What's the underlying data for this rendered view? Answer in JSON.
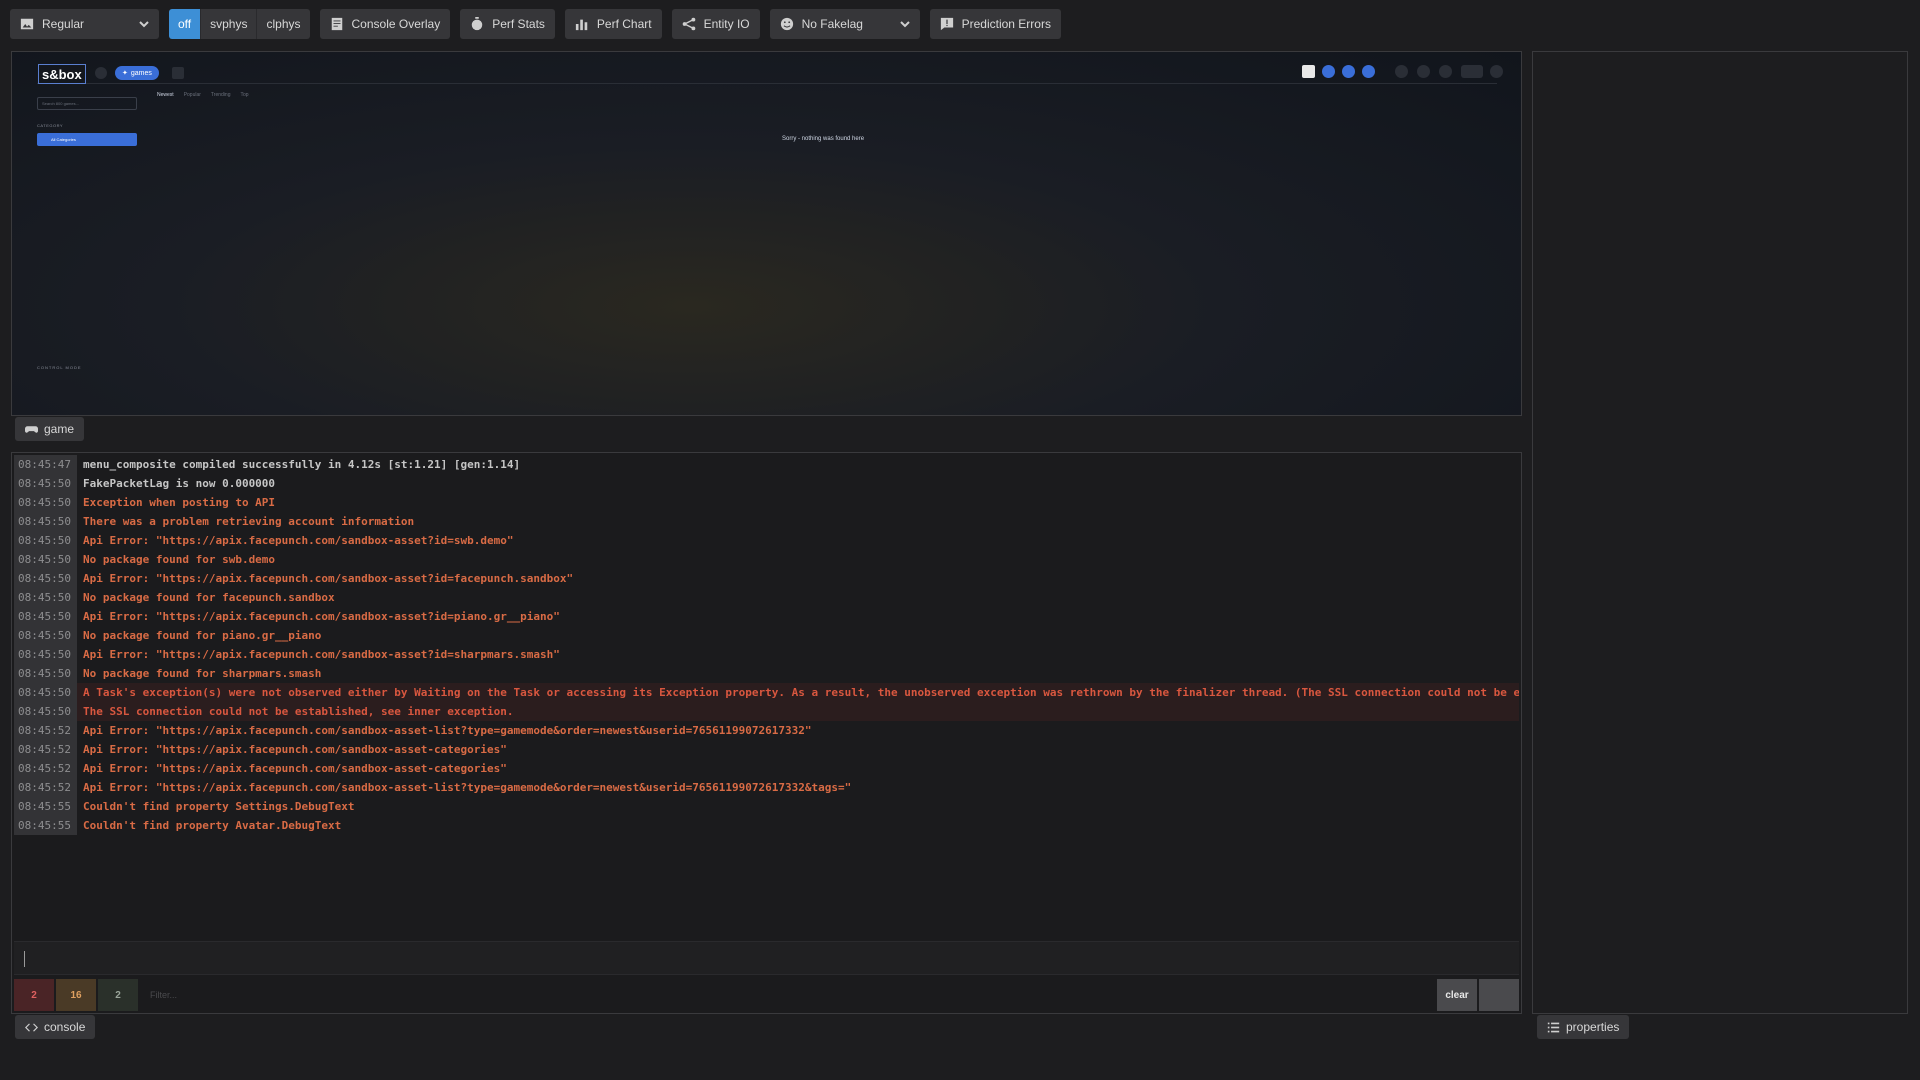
{
  "toolbar": {
    "mode_select": "Regular",
    "physics_segments": [
      {
        "label": "off",
        "active": true
      },
      {
        "label": "svphys",
        "active": false
      },
      {
        "label": "clphys",
        "active": false
      }
    ],
    "console_overlay": "Console Overlay",
    "perf_stats": "Perf Stats",
    "perf_chart": "Perf Chart",
    "entity_io": "Entity IO",
    "fakelag_select": "No Fakelag",
    "prediction_errors": "Prediction Errors"
  },
  "game": {
    "logo": "s&box",
    "pill": "games",
    "tabs": [
      "Newest",
      "Popular",
      "Trending",
      "Top"
    ],
    "search_placeholder": "Search 800 games...",
    "category_label": "CATEGORY",
    "category_button": "All Categories",
    "empty_message": "Sorry - nothing was found here",
    "control_mode": "CONTROL MODE",
    "tab_label": "game"
  },
  "console": {
    "tab_label": "console",
    "lines": [
      {
        "time": "08:45:47",
        "level": "info",
        "text": "menu_composite compiled successfully in 4.12s [st:1.21] [gen:1.14]"
      },
      {
        "time": "08:45:50",
        "level": "info",
        "text": "FakePacketLag is now 0.000000"
      },
      {
        "time": "08:45:50",
        "level": "error",
        "text": "Exception when posting to API"
      },
      {
        "time": "08:45:50",
        "level": "error",
        "text": "There was a problem retrieving account information"
      },
      {
        "time": "08:45:50",
        "level": "error",
        "text": "Api Error: \"https://apix.facepunch.com/sandbox-asset?id=swb.demo\""
      },
      {
        "time": "08:45:50",
        "level": "warn",
        "text": "No package found for swb.demo"
      },
      {
        "time": "08:45:50",
        "level": "error",
        "text": "Api Error: \"https://apix.facepunch.com/sandbox-asset?id=facepunch.sandbox\""
      },
      {
        "time": "08:45:50",
        "level": "warn",
        "text": "No package found for facepunch.sandbox"
      },
      {
        "time": "08:45:50",
        "level": "error",
        "text": "Api Error: \"https://apix.facepunch.com/sandbox-asset?id=piano.gr__piano\""
      },
      {
        "time": "08:45:50",
        "level": "warn",
        "text": "No package found for piano.gr__piano"
      },
      {
        "time": "08:45:50",
        "level": "error",
        "text": "Api Error: \"https://apix.facepunch.com/sandbox-asset?id=sharpmars.smash\""
      },
      {
        "time": "08:45:50",
        "level": "warn",
        "text": "No package found for sharpmars.smash"
      },
      {
        "time": "08:45:50",
        "level": "exception",
        "text": "A Task's exception(s) were not observed either by Waiting on the Task or accessing its Exception property. As a result, the unobserved exception was rethrown by the finalizer thread. (The SSL connection could not be es"
      },
      {
        "time": "08:45:50",
        "level": "exception",
        "text": "The SSL connection could not be established, see inner exception."
      },
      {
        "time": "08:45:52",
        "level": "error",
        "text": "Api Error: \"https://apix.facepunch.com/sandbox-asset-list?type=gamemode&order=newest&userid=76561199072617332\""
      },
      {
        "time": "08:45:52",
        "level": "error",
        "text": "Api Error: \"https://apix.facepunch.com/sandbox-asset-categories\""
      },
      {
        "time": "08:45:52",
        "level": "error",
        "text": "Api Error: \"https://apix.facepunch.com/sandbox-asset-categories\""
      },
      {
        "time": "08:45:52",
        "level": "error",
        "text": "Api Error: \"https://apix.facepunch.com/sandbox-asset-list?type=gamemode&order=newest&userid=76561199072617332&tags=\""
      },
      {
        "time": "08:45:55",
        "level": "error",
        "text": "Couldn't find property Settings.DebugText"
      },
      {
        "time": "08:45:55",
        "level": "error",
        "text": "Couldn't find property Avatar.DebugText"
      }
    ],
    "counts": {
      "errors": "2",
      "warnings": "16",
      "info": "2"
    },
    "filter_placeholder": "Filter...",
    "clear_label": "clear"
  },
  "properties": {
    "tab_label": "properties"
  },
  "colors": {
    "accent": "#3d8fd6",
    "error_text": "#d96b45",
    "game_accent": "#3a6ed8"
  }
}
